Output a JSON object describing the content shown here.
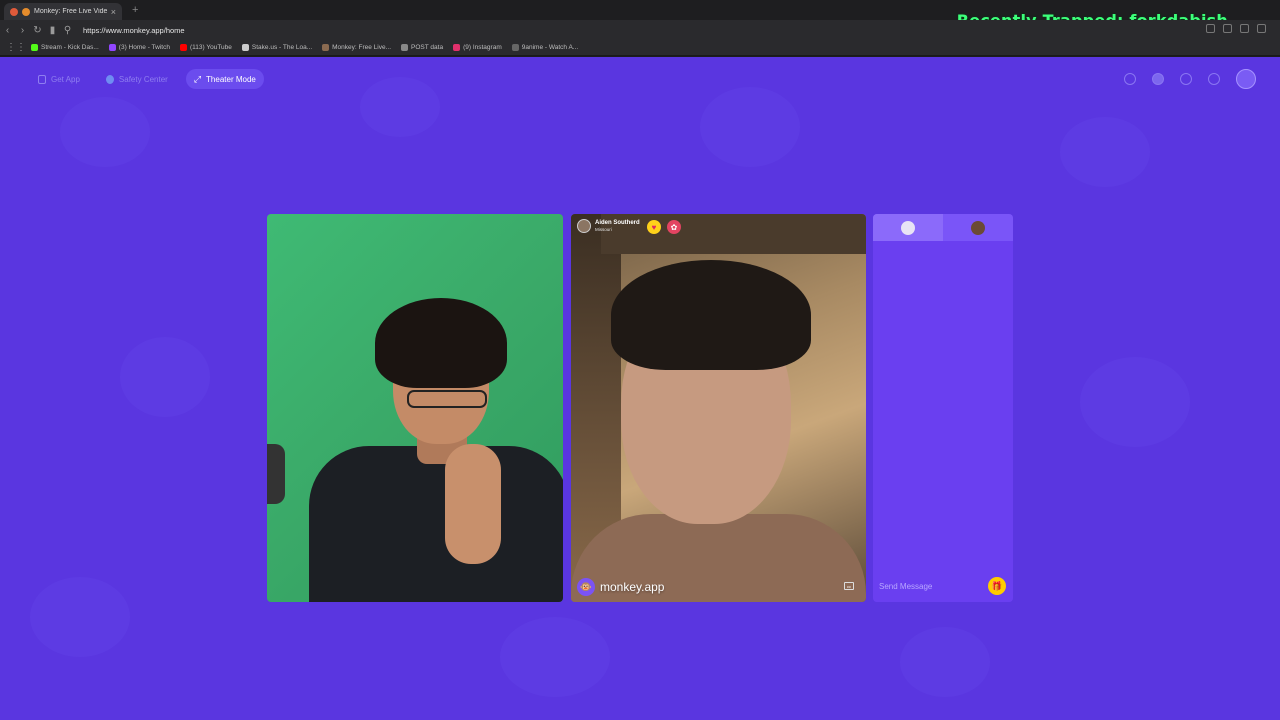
{
  "browser": {
    "tab_title": "Monkey: Free Live Video Chat",
    "tab_close": "×",
    "new_tab": "+",
    "url": "https://www.monkey.app/home",
    "overlay_text": "Recently Trapped: forkdabish",
    "bookmarks": [
      {
        "label": "Stream - Kick Das...",
        "color": "#53fc18"
      },
      {
        "label": "(3) Home - Twitch",
        "color": "#9146ff"
      },
      {
        "label": "(113) YouTube",
        "color": "#ff0000"
      },
      {
        "label": "Stake.us - The Loa...",
        "color": "#cccccc"
      },
      {
        "label": "Monkey: Free Live...",
        "color": "#8a6a50"
      },
      {
        "label": "POST data",
        "color": "#888888"
      },
      {
        "label": "(9) Instagram",
        "color": "#e1306c"
      },
      {
        "label": "9anime - Watch A...",
        "color": "#666666"
      }
    ]
  },
  "nav": {
    "get_app": "Get App",
    "safety_center": "Safety Center",
    "theater_mode": "Theater Mode"
  },
  "remote_user": {
    "name": "Aiden Southerd",
    "location": "Missouri"
  },
  "brand": {
    "name": "monkey.app",
    "logo": "🐵"
  },
  "chat": {
    "placeholder": "Send Message",
    "gift_icon": "🎁"
  },
  "colors": {
    "page_bg": "#5a36e0",
    "accent": "#6b4cee",
    "gift": "#ffcc00",
    "overlay": "#3dff7a"
  }
}
